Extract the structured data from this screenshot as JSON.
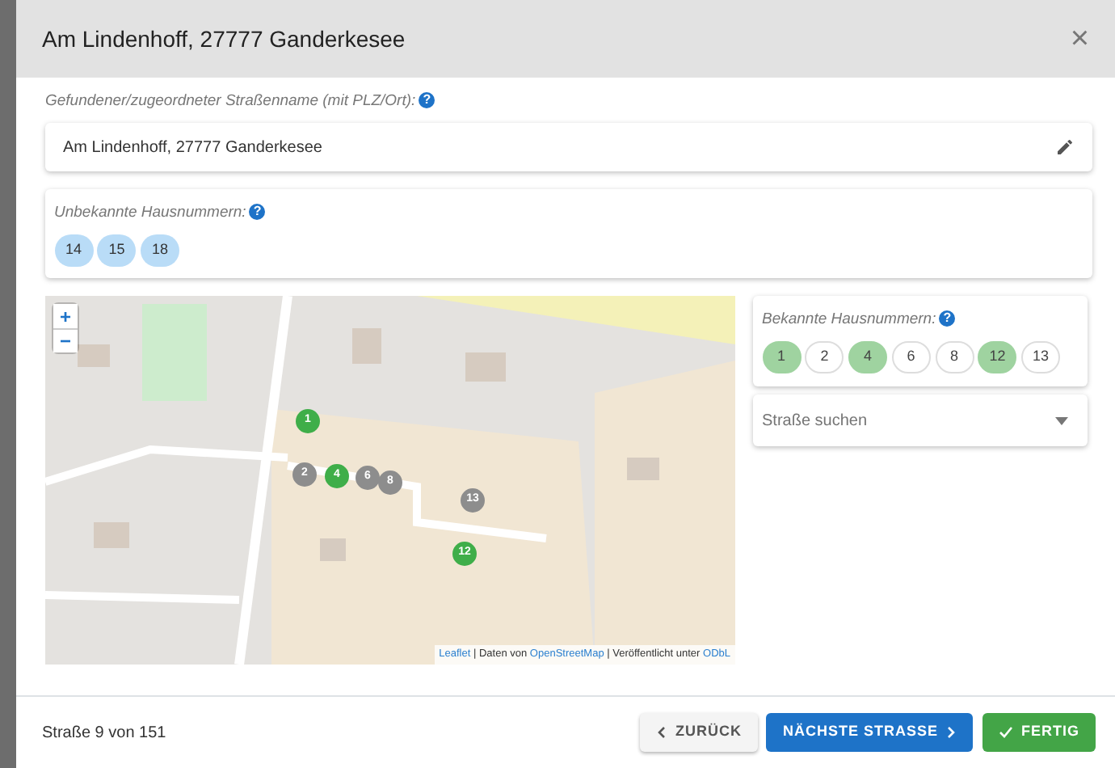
{
  "dialog": {
    "title": "Am Lindenhoff, 27777 Ganderkesee",
    "close": "×"
  },
  "street_name": {
    "label": "Gefundener/zugeordneter Straßenname (mit PLZ/Ort):",
    "help": "?",
    "value": "Am Lindenhoff, 27777 Ganderkesee"
  },
  "unknown_numbers": {
    "label": "Unbekannte Hausnummern:",
    "help": "?",
    "items": [
      "14",
      "15",
      "18"
    ]
  },
  "map": {
    "zoom_in": "+",
    "zoom_out": "−",
    "markers": [
      {
        "label": "1",
        "known": true
      },
      {
        "label": "2",
        "known": false
      },
      {
        "label": "4",
        "known": true
      },
      {
        "label": "6",
        "known": false
      },
      {
        "label": "8",
        "known": false
      },
      {
        "label": "13",
        "known": false
      },
      {
        "label": "12",
        "known": true
      }
    ],
    "attribution": [
      {
        "text": "Leaflet",
        "link": true
      },
      {
        "text": " | Daten von ",
        "link": false
      },
      {
        "text": "OpenStreetMap",
        "link": true
      },
      {
        "text": " | Veröffentlicht unter ",
        "link": false
      },
      {
        "text": "ODbL",
        "link": true
      }
    ]
  },
  "known_numbers": {
    "label": "Bekannte Hausnummern:",
    "help": "?",
    "items": [
      {
        "label": "1",
        "selected": true
      },
      {
        "label": "2",
        "selected": false
      },
      {
        "label": "4",
        "selected": true
      },
      {
        "label": "6",
        "selected": false
      },
      {
        "label": "8",
        "selected": false
      },
      {
        "label": "12",
        "selected": true
      },
      {
        "label": "13",
        "selected": false
      }
    ]
  },
  "street_search": {
    "placeholder": "Straße suchen"
  },
  "footer": {
    "progress": "Straße 9 von 151",
    "buttons": [
      {
        "label": "ZURÜCK",
        "kind": "back"
      },
      {
        "label": "NÄCHSTE STRASSE",
        "kind": "next"
      },
      {
        "label": "FERTIG",
        "kind": "done"
      }
    ]
  }
}
